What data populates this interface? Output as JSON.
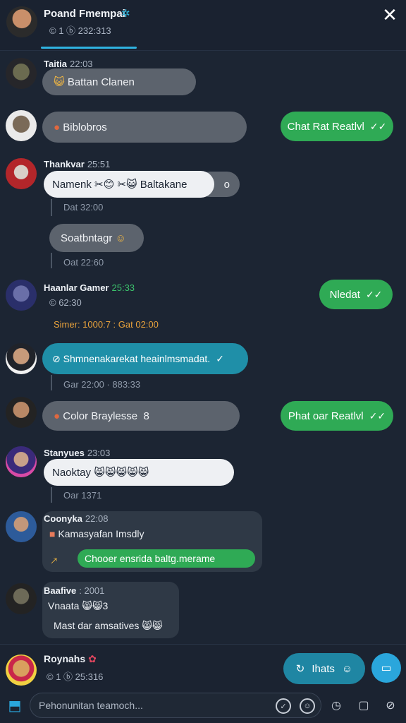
{
  "header": {
    "title": "Poand Fmempai",
    "verified_icon": "gear-verified-icon",
    "subtitle": "© 1 ⓑ 232:313",
    "close_icon": "close-icon"
  },
  "messages": [
    {
      "sender": "Taitia",
      "time": "22:03",
      "text": "Battan Clanen",
      "emoji": "😺"
    },
    {
      "text": "Biblobros",
      "reply": "Chat Rat Reatlvl"
    },
    {
      "sender": "Thankvar",
      "time": "25:51",
      "text": "Namenk ✂😊 ✂😺 Baltakane",
      "tail": "o",
      "meta1": "Dat 32:00",
      "reply_bubble": "Soatbntagr",
      "meta2": "Oat 22:60"
    },
    {
      "sender": "Haanlar Gamer",
      "time": "25:33",
      "sub": "© 62:30",
      "meta": "Simer: 1000:7 : Gat 02:00",
      "reply": "Nledat"
    },
    {
      "text": "Shmnenakarekat heainlmsmadat.",
      "meta": "Gar 22:00  ·  883:33"
    },
    {
      "text": "Color Braylesse",
      "icon": "8",
      "reply": "Phat oar Reatlvl"
    },
    {
      "sender": "Stanyues",
      "time": "23:03",
      "text": "Naoktay 😸😸😸😸😸",
      "meta": "Oar 1371"
    },
    {
      "sender": "Coonyka",
      "time": "22:08",
      "line1": "Kamasyafan Imsdly",
      "line2": "Chooer ensrida baltg.merame"
    },
    {
      "sender": "Baafive",
      "time": ": 2001",
      "line1": "Vnaata 😸😸3",
      "line2": "Mast dar amsatives 😸😸"
    }
  ],
  "footer": {
    "name": "Roynahs",
    "sub": "© 1 ⓑ 25:316",
    "share_label": "Ihats",
    "input_placeholder": "Pehonunitan teamoch..."
  }
}
